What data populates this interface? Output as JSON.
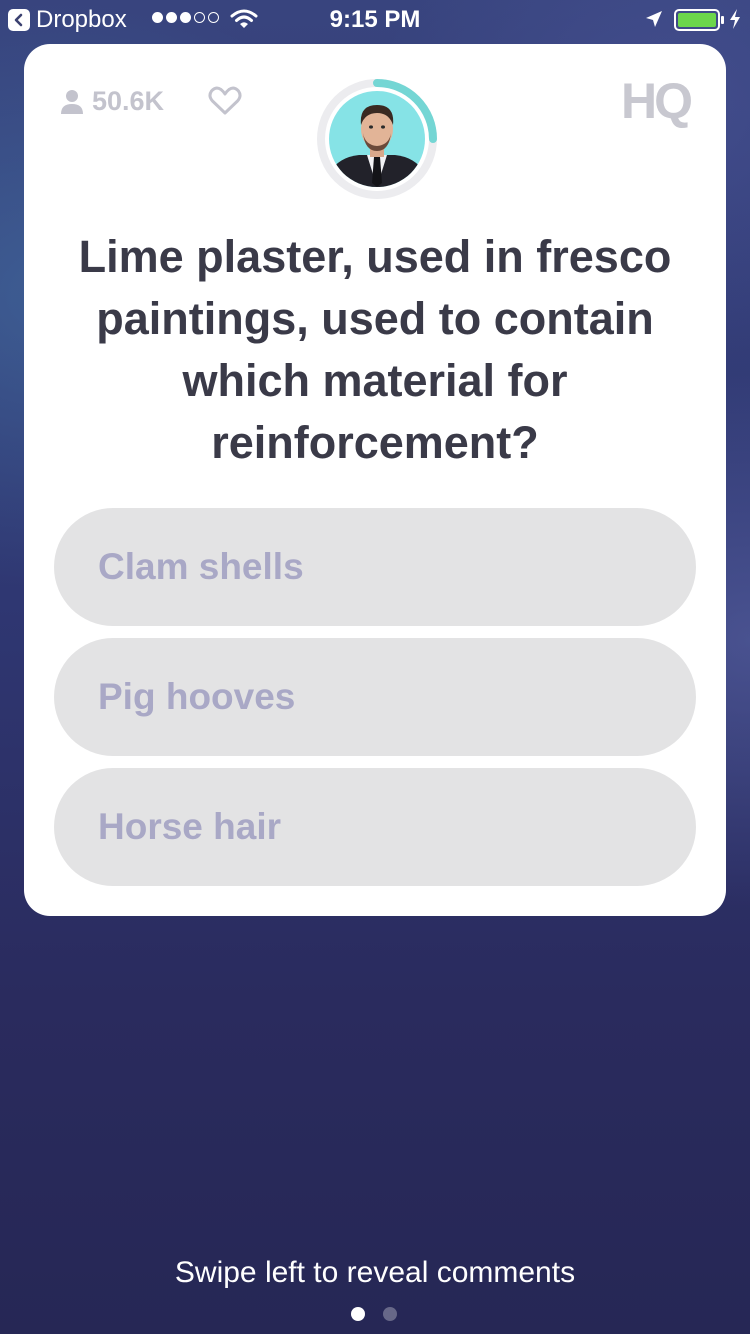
{
  "status_bar": {
    "back_app": "Dropbox",
    "signal": {
      "filled": 3,
      "total": 5
    },
    "time": "9:15 PM",
    "battery_level": 1.0,
    "battery_color": "#6cd64b"
  },
  "card": {
    "viewer_count": "50.6K",
    "logo_text": "HQ",
    "timer_ring_color": "#74d6d4",
    "question": "Lime plaster, used in fresco paintings, used to contain which material for reinforcement?",
    "answers": [
      {
        "label": "Clam shells"
      },
      {
        "label": "Pig hooves"
      },
      {
        "label": "Horse hair"
      }
    ]
  },
  "footer": {
    "hint": "Swipe left to reveal comments",
    "pages": 2,
    "active_page": 1
  },
  "icons": {
    "back": "chevron-left-icon",
    "wifi": "wifi-icon",
    "location": "location-arrow-icon",
    "battery": "battery-icon",
    "charging": "lightning-bolt-icon",
    "viewers": "person-icon",
    "like": "heart-icon"
  }
}
